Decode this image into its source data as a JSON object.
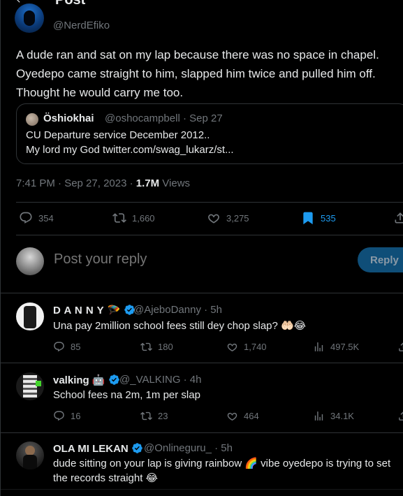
{
  "header": {
    "title": "Post"
  },
  "post": {
    "handle": "@NerdEfiko",
    "text": "A dude ran and sat on my lap because there was no space in chapel. Oyedepo came straight to him, slapped him twice and pulled him off. Thought he would carry me too.",
    "quote": {
      "name": "Öshiokhai",
      "meta": "@oshocampbell · Sep 27",
      "line1": "CU Departure service December 2012..",
      "line2": "My lord my God twitter.com/swag_lukarz/st..."
    },
    "timestamp": "7:41 PM · Sep 27, 2023 · ",
    "views_count": "1.7M",
    "views_label": " Views",
    "stats": {
      "replies": "354",
      "reposts": "1,660",
      "likes": "3,275",
      "bookmarks": "535"
    },
    "accent": "#1d9bf0"
  },
  "composer": {
    "placeholder": "Post your reply",
    "button": "Reply"
  },
  "replies": [
    {
      "name": "D A N N Y",
      "meta": "@AjeboDanny · 5h",
      "text": "Una pay 2million school fees still dey chop slap? 🤲🏻😂",
      "replies": "85",
      "reposts": "180",
      "likes": "1,740",
      "views": "497.5K"
    },
    {
      "name": "valking 🤖",
      "meta": "@_VALKING · 4h",
      "text": "School fees na 2m, 1m per slap",
      "replies": "16",
      "reposts": "23",
      "likes": "464",
      "views": "34.1K"
    },
    {
      "name": "OLA MI LEKAN",
      "meta": "@Onlineguru_ · 5h",
      "text": "dude sitting on your lap is giving rainbow 🌈 vibe oyedepo is trying to set the records straight 😂",
      "replies": "",
      "reposts": "",
      "likes": "",
      "views": ""
    }
  ]
}
